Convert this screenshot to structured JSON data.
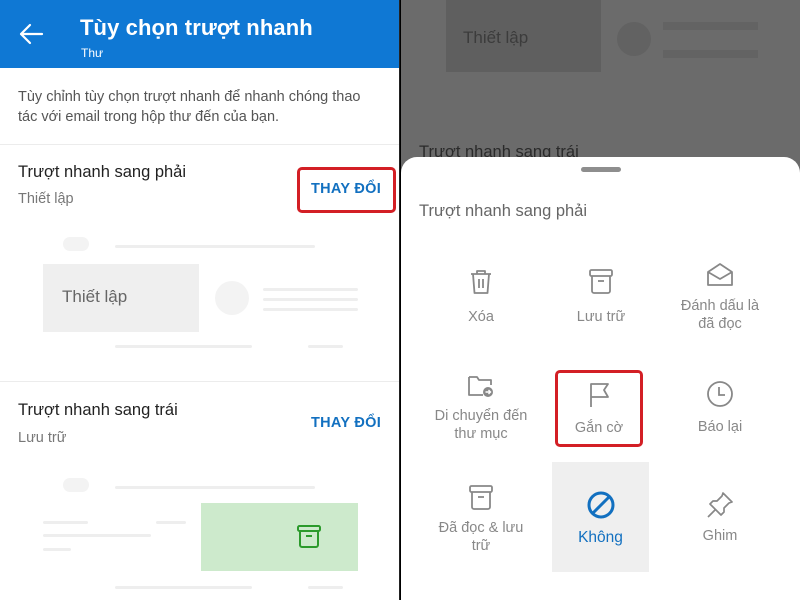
{
  "left": {
    "header": {
      "title": "Tùy chọn trượt nhanh",
      "subtitle": "Thư",
      "back_icon": "arrow-left-icon",
      "background": "#0f78d4"
    },
    "description": "Tùy chỉnh tùy chọn trượt nhanh để nhanh chóng thao tác với email trong hộp thư đến của bạn.",
    "sections": [
      {
        "title": "Trượt nhanh sang phải",
        "value": "Thiết lập",
        "change_label": "THAY ĐỔI",
        "highlighted": true,
        "preview": {
          "action_label": "Thiết lập",
          "action_color": "#efefef"
        }
      },
      {
        "title": "Trượt nhanh sang trái",
        "value": "Lưu trữ",
        "change_label": "THAY ĐỔI",
        "highlighted": false,
        "preview": {
          "action_icon": "archive-icon",
          "action_color": "#cdeacc",
          "icon_color": "#2b9a2b"
        }
      }
    ]
  },
  "right": {
    "background": {
      "preview_label": "Thiết lập",
      "section_title": "Trượt nhanh sang trái"
    },
    "sheet": {
      "title": "Trượt nhanh sang phải",
      "options": [
        {
          "label": "Xóa",
          "icon": "trash-icon"
        },
        {
          "label": "Lưu trữ",
          "icon": "archive-icon"
        },
        {
          "label": "Đánh dấu là đã đọc",
          "icon": "envelope-open-icon"
        },
        {
          "label": "Di chuyển đến thư mục",
          "icon": "folder-move-icon"
        },
        {
          "label": "Gắn cờ",
          "icon": "flag-icon",
          "highlighted": true
        },
        {
          "label": "Báo lại",
          "icon": "clock-icon"
        },
        {
          "label": "Đã đọc & lưu trữ",
          "icon": "archive-icon"
        },
        {
          "label": "Không",
          "icon": "prohibited-icon",
          "selected": true
        },
        {
          "label": "Ghim",
          "icon": "pin-icon"
        }
      ]
    }
  },
  "colors": {
    "accent": "#1270c0",
    "highlight_border": "#d31f25",
    "muted_text": "#888888"
  }
}
